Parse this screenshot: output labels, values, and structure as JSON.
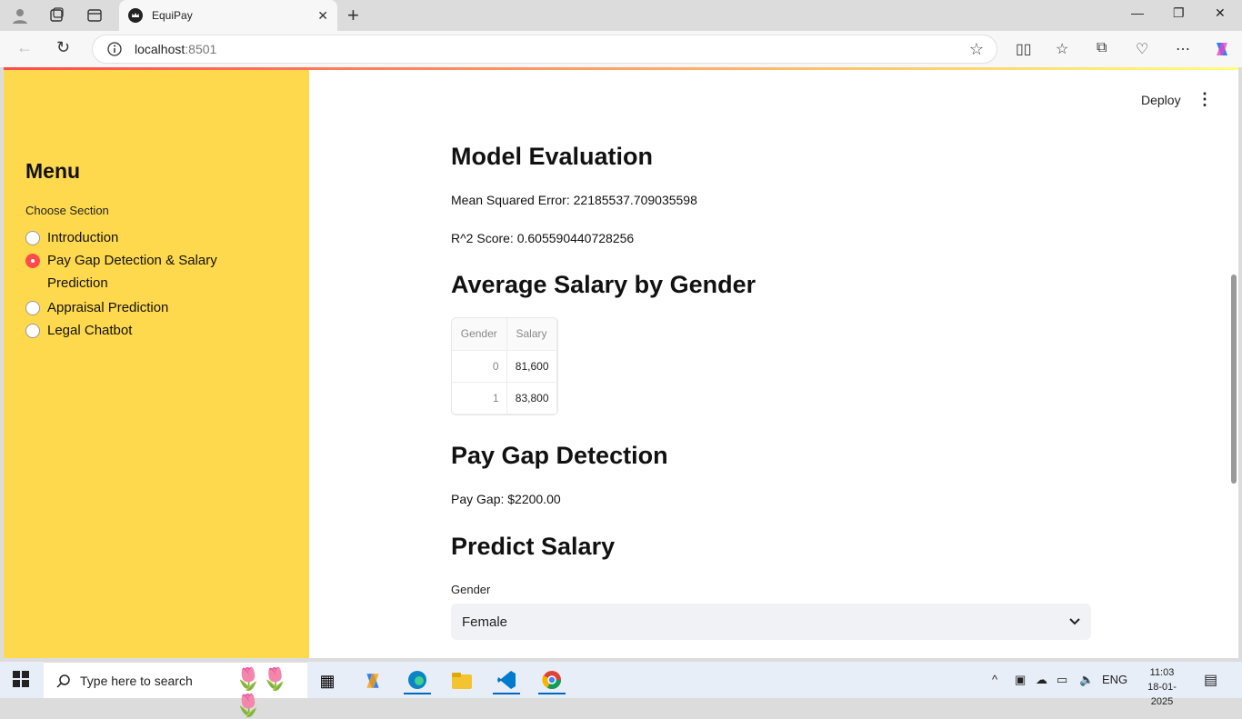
{
  "browser": {
    "tab_title": "EquiPay",
    "url_host": "localhost",
    "url_port": ":8501",
    "new_tab_glyph": "+",
    "close_glyph": "✕"
  },
  "app": {
    "deploy_label": "Deploy",
    "sidebar": {
      "title": "Menu",
      "section_label": "Choose Section",
      "options": [
        {
          "label": "Introduction",
          "selected": false
        },
        {
          "label": "Pay Gap Detection & Salary Prediction",
          "selected": true
        },
        {
          "label": "Appraisal Prediction",
          "selected": false
        },
        {
          "label": "Legal Chatbot",
          "selected": false
        }
      ]
    },
    "main": {
      "model_eval_title": "Model Evaluation",
      "mse_text": "Mean Squared Error: 22185537.709035598",
      "r2_text": "R^2 Score: 0.605590440728256",
      "avg_salary_title": "Average Salary by Gender",
      "table": {
        "columns": [
          "Gender",
          "Salary"
        ],
        "rows": [
          {
            "gender": "0",
            "salary": "81,600"
          },
          {
            "gender": "1",
            "salary": "83,800"
          }
        ]
      },
      "pay_gap_title": "Pay Gap Detection",
      "pay_gap_text": "Pay Gap: $2200.00",
      "predict_title": "Predict Salary",
      "gender_label": "Gender",
      "gender_value": "Female"
    }
  },
  "taskbar": {
    "search_placeholder": "Type here to search",
    "language": "ENG",
    "time": "11:03",
    "date": "18-01-2025"
  },
  "colors": {
    "sidebar_bg": "#ffd94d",
    "accent": "#ff4b4b"
  }
}
